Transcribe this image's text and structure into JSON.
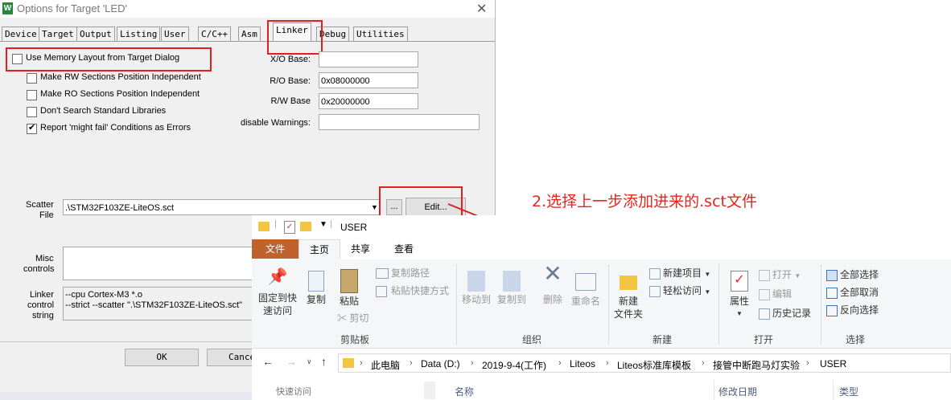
{
  "dialog": {
    "title": "Options for Target 'LED'",
    "app_icon": "W",
    "close_glyph": "✕",
    "tabs": [
      "Device",
      "Target",
      "Output",
      "Listing",
      "User",
      "C/C++",
      "Asm",
      "Linker",
      "Debug",
      "Utilities"
    ],
    "active_tab": "Linker",
    "checkboxes": [
      {
        "label": "Use Memory Layout from Target Dialog",
        "checked": false
      },
      {
        "label": "Make RW Sections Position Independent",
        "checked": false
      },
      {
        "label": "Make RO Sections Position Independent",
        "checked": false
      },
      {
        "label": "Don't Search Standard Libraries",
        "checked": false
      },
      {
        "label": "Report 'might fail' Conditions as Errors",
        "checked": true
      }
    ],
    "fields": [
      {
        "label": "X/O Base:",
        "value": ""
      },
      {
        "label": "R/O Base:",
        "value": "0x08000000"
      },
      {
        "label": "R/W Base",
        "value": "0x20000000"
      },
      {
        "label": "disable Warnings:",
        "value": ""
      }
    ],
    "scatter": {
      "label_line1": "Scatter",
      "label_line2": "File",
      "value": ".\\STM32F103ZE-LiteOS.sct",
      "browse_label": "...",
      "edit_label": "Edit..."
    },
    "misc": {
      "label_line1": "Misc",
      "label_line2": "controls",
      "value": ""
    },
    "linker_control": {
      "label_line1": "Linker",
      "label_line2": "control",
      "label_line3": "string",
      "line1": "--cpu Cortex-M3 *.o",
      "line2": "--strict --scatter \".\\STM32F103ZE-LiteOS.sct\""
    },
    "ok_label": "OK",
    "cancel_label": "Cance"
  },
  "annotation": "2.选择上一步添加进来的.sct文件",
  "explorer": {
    "title": "USER",
    "ribbon_tabs": [
      "文件",
      "主页",
      "共享",
      "查看"
    ],
    "active_tab": "主页",
    "clipboard": {
      "pin_line1": "固定到快",
      "pin_line2": "速访问",
      "copy": "复制",
      "paste": "粘贴",
      "copy_path": "复制路径",
      "paste_shortcut": "粘贴快捷方式",
      "cut": "剪切",
      "group": "剪贴板"
    },
    "organize": {
      "move_to": "移动到",
      "copy_to": "复制到",
      "delete": "删除",
      "rename": "重命名",
      "group": "组织"
    },
    "new": {
      "new_folder_line1": "新建",
      "new_folder_line2": "文件夹",
      "new_item": "新建项目",
      "easy_access": "轻松访问",
      "group": "新建"
    },
    "open": {
      "properties": "属性",
      "open": "打开",
      "edit": "编辑",
      "history": "历史记录",
      "group": "打开"
    },
    "select": {
      "select_all": "全部选择",
      "select_none": "全部取消",
      "invert": "反向选择",
      "group": "选择"
    },
    "breadcrumb": [
      "此电脑",
      "Data (D:)",
      "2019-9-4(工作)",
      "Liteos",
      "Liteos标准库模板",
      "接管中断跑马灯实验",
      "USER"
    ],
    "columns": [
      "名称",
      "修改日期",
      "类型"
    ],
    "nav_quick": "快速访问"
  },
  "colors": {
    "accent_red": "#e02020",
    "file_tab": "#c0622b",
    "annotation": "#e8241a"
  }
}
